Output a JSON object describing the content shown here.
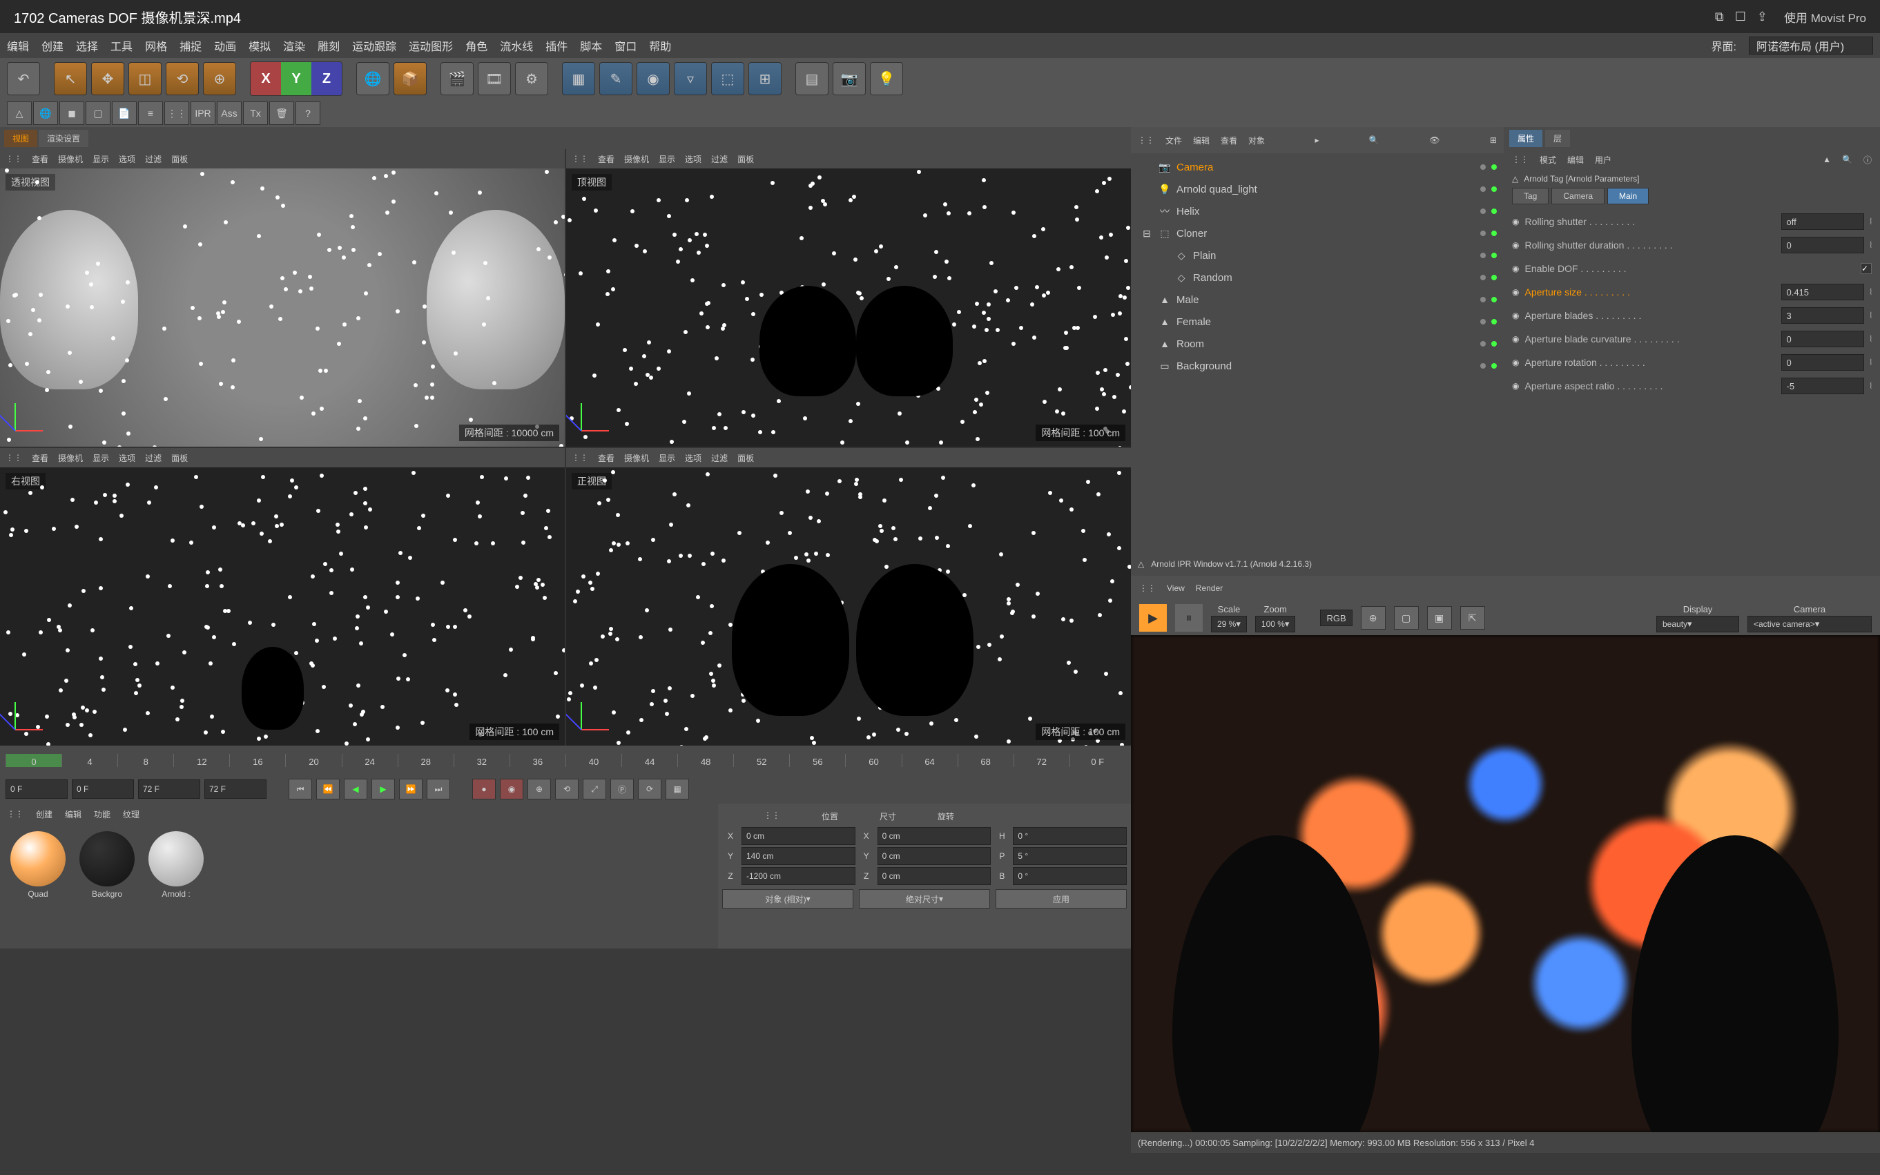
{
  "title": "1702 Cameras DOF 摄像机景深.mp4",
  "player": "使用 Movist Pro",
  "menu": [
    "编辑",
    "创建",
    "选择",
    "工具",
    "网格",
    "捕捉",
    "动画",
    "模拟",
    "渲染",
    "雕刻",
    "运动跟踪",
    "运动图形",
    "角色",
    "流水线",
    "插件",
    "脚本",
    "窗口",
    "帮助"
  ],
  "layout_label": "界面:",
  "layout_value": "阿诺德布局 (用户)",
  "toolbar2": [
    "IPR",
    "Ass",
    "Tx"
  ],
  "view_tabs": [
    "视图",
    "渲染设置"
  ],
  "vp_menu": [
    "查看",
    "摄像机",
    "显示",
    "选项",
    "过滤",
    "面板"
  ],
  "vp_labels": {
    "persp": "透视视图",
    "top": "顶视图",
    "right": "右视图",
    "front": "正视图"
  },
  "vp_grid": {
    "persp": "网格间距 : 10000 cm",
    "top": "网格间距 : 100 cm",
    "right": "网格间距 : 100 cm",
    "front": "网格间距 : 100 cm"
  },
  "timeline": [
    "0",
    "4",
    "8",
    "12",
    "16",
    "20",
    "24",
    "28",
    "32",
    "36",
    "40",
    "44",
    "48",
    "52",
    "56",
    "60",
    "64",
    "68",
    "72",
    "0 F"
  ],
  "playbar": {
    "start": "0 F",
    "cur": "0 F",
    "end": "72 F",
    "end2": "72 F"
  },
  "mat_menu": [
    "创建",
    "编辑",
    "功能",
    "纹理"
  ],
  "materials": [
    {
      "name": "Quad",
      "grad": "radial-gradient(circle at 35% 30%,#fff,#ffb060 40%,#b07030)"
    },
    {
      "name": "Backgro",
      "grad": "radial-gradient(circle at 35% 30%,#333,#111)"
    },
    {
      "name": "Arnold :",
      "grad": "radial-gradient(circle at 35% 30%,#eee,#999)"
    }
  ],
  "coord": {
    "hdrs": [
      "位置",
      "尺寸",
      "旋转"
    ],
    "rows": [
      {
        "axis": "X",
        "p": "0 cm",
        "s": "0 cm",
        "r": "H",
        "rv": "0 °"
      },
      {
        "axis": "Y",
        "p": "140 cm",
        "s": "0 cm",
        "r": "P",
        "rv": "5 °"
      },
      {
        "axis": "Z",
        "p": "-1200 cm",
        "s": "0 cm",
        "r": "B",
        "rv": "0 °"
      }
    ],
    "btns": [
      "对象 (相对)",
      "绝对尺寸",
      "应用"
    ]
  },
  "obj_menu": [
    "文件",
    "编辑",
    "查看",
    "对象"
  ],
  "objects": [
    {
      "name": "Camera",
      "sel": true,
      "indent": 0,
      "icon": "📷"
    },
    {
      "name": "Arnold quad_light",
      "indent": 0,
      "icon": "💡"
    },
    {
      "name": "Helix",
      "indent": 0,
      "icon": "〰"
    },
    {
      "name": "Cloner",
      "indent": 0,
      "icon": "⬚",
      "exp": true
    },
    {
      "name": "Plain",
      "indent": 1,
      "icon": "◇"
    },
    {
      "name": "Random",
      "indent": 1,
      "icon": "◇"
    },
    {
      "name": "Male",
      "indent": 0,
      "icon": "▲"
    },
    {
      "name": "Female",
      "indent": 0,
      "icon": "▲"
    },
    {
      "name": "Room",
      "indent": 0,
      "icon": "▲"
    },
    {
      "name": "Background",
      "indent": 0,
      "icon": "▭"
    }
  ],
  "prop_tabs": [
    "属性",
    "层"
  ],
  "prop_menu": [
    "模式",
    "编辑",
    "用户"
  ],
  "prop_title": "Arnold Tag [Arnold Parameters]",
  "prop_tabs2": [
    "Tag",
    "Camera",
    "Main"
  ],
  "props": [
    {
      "label": "Rolling shutter",
      "value": "off",
      "type": "sel"
    },
    {
      "label": "Rolling shutter duration",
      "value": "0",
      "type": "num"
    },
    {
      "label": "Enable DOF",
      "value": "on",
      "type": "chk"
    },
    {
      "label": "Aperture size",
      "value": "0.415",
      "type": "num",
      "hl": true
    },
    {
      "label": "Aperture blades",
      "value": "3",
      "type": "num"
    },
    {
      "label": "Aperture blade curvature",
      "value": "0",
      "type": "num"
    },
    {
      "label": "Aperture rotation",
      "value": "0",
      "type": "num"
    },
    {
      "label": "Aperture aspect ratio",
      "value": "-5",
      "type": "num"
    }
  ],
  "ipr": {
    "title": "Arnold IPR Window v1.7.1 (Arnold 4.2.16.3)",
    "menu": [
      "View",
      "Render"
    ],
    "scale_lbl": "Scale",
    "scale": "29 %",
    "zoom_lbl": "Zoom",
    "zoom": "100 %",
    "display_lbl": "Display",
    "display": "beauty",
    "camera_lbl": "Camera",
    "camera": "<active camera>",
    "rgb": "RGB",
    "status": "(Rendering...)   00:00:05   Sampling: [10/2/2/2/2/2]   Memory: 993.00 MB   Resolution: 556 x 313 / Pixel 4"
  }
}
